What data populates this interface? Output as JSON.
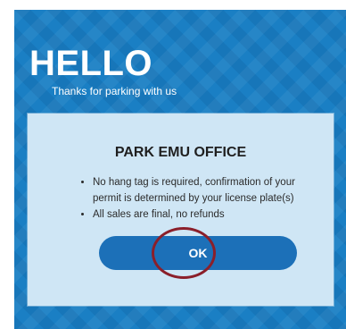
{
  "header": {
    "title": "HELLO",
    "tagline": "Thanks for parking with us"
  },
  "dialog": {
    "title": "PARK EMU OFFICE",
    "rules": [
      "No hang tag is required, confirmation of your permit is determined by your license plate(s)",
      "All sales are final, no refunds"
    ],
    "ok_label": "OK"
  },
  "colors": {
    "background": "#1a7fc4",
    "dialog": "#cfe6f5",
    "button": "#1c70b8",
    "annotation": "#8b1f2a"
  }
}
